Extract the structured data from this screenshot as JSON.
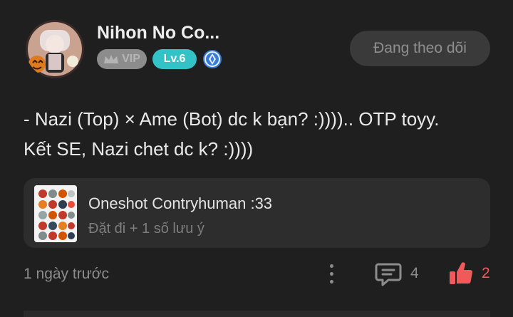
{
  "author": {
    "name": "Nihon No Co...",
    "vip_label": "VIP",
    "level_label": "Lv.6"
  },
  "follow_button": {
    "label": "Đang theo dõi"
  },
  "post": {
    "lines": [
      "- Nazi (Top) × Ame (Bot) dc k bạn? :)))).. OTP toyy.",
      "Kết SE, Nazi chet dc k? :))))"
    ]
  },
  "attachment": {
    "title": "Oneshot Contryhuman :33",
    "subtitle": "Đặt đi + 1 số lưu ý"
  },
  "footer": {
    "timestamp": "1 ngày trước",
    "comment_count": "4",
    "like_count": "2"
  },
  "colors": {
    "background": "#1f1f1f",
    "level_badge": "#33c2c6",
    "like_accent": "#f05a5a",
    "card": "#2d2d2d"
  },
  "icons": {
    "rank": "blue-gem-rank-icon",
    "more": "vertical-dots-icon",
    "comment": "comment-bubble-icon",
    "like": "thumbs-up-icon"
  }
}
